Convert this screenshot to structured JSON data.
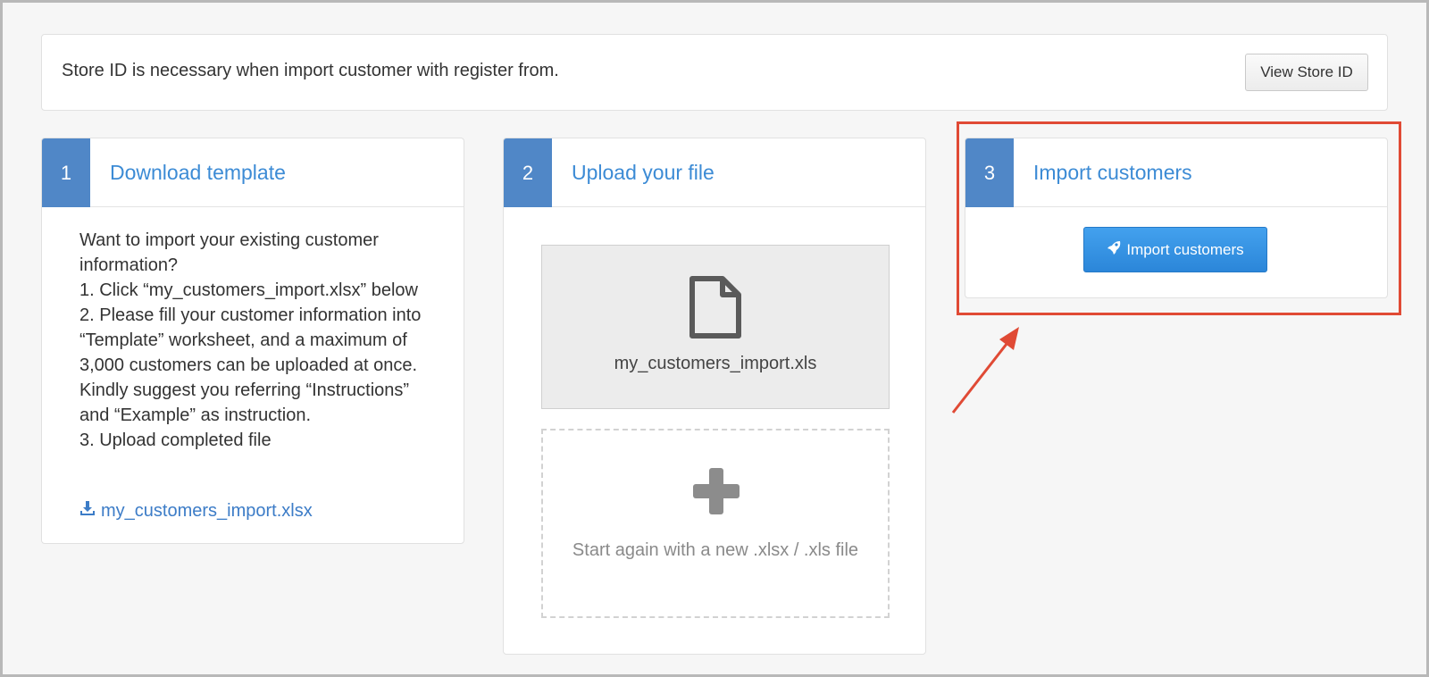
{
  "info": {
    "text": "Store ID is necessary when import customer with register from.",
    "view_button": "View Store ID"
  },
  "steps": [
    {
      "number": "1",
      "title": "Download template"
    },
    {
      "number": "2",
      "title": "Upload your file"
    },
    {
      "number": "3",
      "title": "Import customers"
    }
  ],
  "download": {
    "instructions": [
      "Want to import your existing customer information?",
      "1. Click “my_customers_import.xlsx” below",
      "2. Please fill your customer information into “Template” worksheet, and a maximum of 3,000 customers can be uploaded at once. Kindly suggest you referring “Instructions” and “Example” as instruction.",
      "3. Upload completed file"
    ],
    "link_label": "my_customers_import.xlsx",
    "link_icon": "download-icon"
  },
  "upload": {
    "file_name": "my_customers_import.xls",
    "file_icon": "file-icon",
    "add_icon": "plus-icon",
    "restart_text": "Start again with a new .xlsx / .xls file"
  },
  "import": {
    "button_label": "Import customers",
    "button_icon": "rocket-icon"
  },
  "colors": {
    "accent": "#3c8bd5",
    "step_badge": "#5087c7",
    "import_button": "#3a97e6",
    "annotation": "#e04a35"
  }
}
